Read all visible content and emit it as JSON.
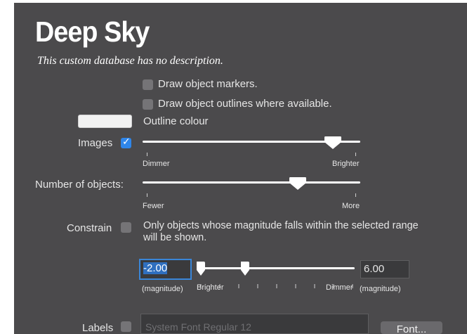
{
  "header": {
    "title": "Deep Sky",
    "description": "This custom database has no description."
  },
  "options": {
    "draw_markers": {
      "label": "Draw object markers.",
      "checked": false
    },
    "draw_outlines": {
      "label": "Draw object outlines where available.",
      "checked": false
    },
    "outline_colour": {
      "label": "Outline colour",
      "value": "#f2f2f2"
    }
  },
  "images": {
    "label": "Images",
    "checked": true,
    "slider": {
      "min_label": "Dimmer",
      "max_label": "Brighter",
      "value_fraction": 0.89
    }
  },
  "number_of_objects": {
    "label": "Number of objects:",
    "slider": {
      "min_label": "Fewer",
      "max_label": "More",
      "value_fraction": 0.71
    }
  },
  "constrain": {
    "label": "Constrain",
    "checked": false,
    "note": "Only objects whose magnitude falls within the selected range will be shown.",
    "min_value": "-2.00",
    "max_value": "6.00",
    "min_unit": "(magnitude)",
    "max_unit": "(magnitude)",
    "range_min_label": "Brighter",
    "range_max_label": "Dimmer",
    "range_low_fraction": 0.0,
    "range_high_fraction": 0.3
  },
  "labels": {
    "label": "Labels",
    "checked": false,
    "font_field": "System Font Regular 12",
    "font_button": "Font..."
  },
  "colors": {
    "accent": "#2f86ea",
    "panel": "#4b4a4c"
  }
}
